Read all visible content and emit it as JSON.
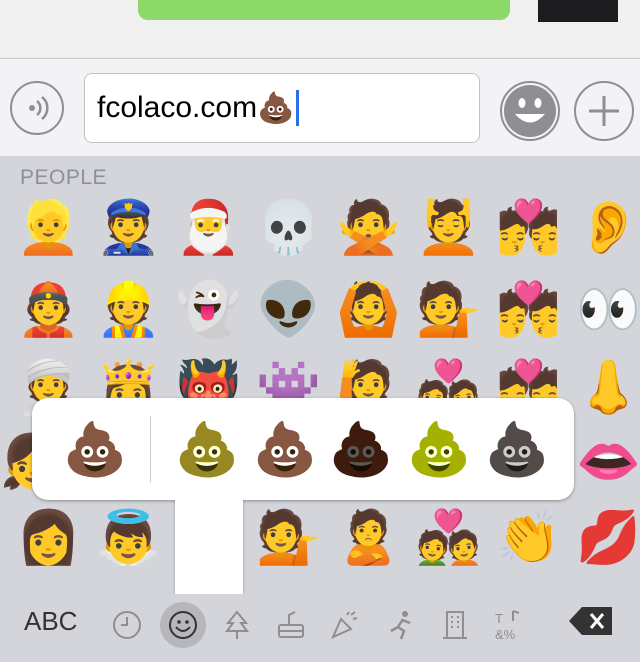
{
  "input": {
    "text": "fcolaco.com",
    "trailing_emoji": "💩"
  },
  "keyboard": {
    "section_title": "PEOPLE",
    "grid": [
      [
        "👱",
        "👮",
        "🎅",
        "💀",
        "🙅",
        "💆",
        "💏",
        "👂"
      ],
      [
        "👲",
        "👷",
        "👻",
        "👽",
        "🙆",
        "💁",
        "💏",
        "👀"
      ],
      [
        "👳",
        "👸",
        "👹",
        "👾",
        "🙋",
        "💑",
        "💏",
        "👃"
      ],
      [
        "👩",
        "👼",
        "",
        "💁",
        "🙎",
        "💑",
        "👏",
        "💋"
      ]
    ],
    "row4_left": "👧",
    "row4_right": "👄",
    "abc_label": "ABC",
    "categories": [
      "recent-icon",
      "smiley-icon",
      "tree-icon",
      "food-icon",
      "party-icon",
      "runner-icon",
      "building-icon",
      "symbols-icon"
    ]
  },
  "variant_popup": {
    "default": "💩",
    "variants": [
      "💩",
      "💩",
      "💩",
      "💩",
      "💩"
    ],
    "variant_filters": [
      "sepia(1) saturate(3) hue-rotate(15deg) brightness(1.1)",
      "none",
      "brightness(0.35) saturate(2)",
      "sepia(1) saturate(6) hue-rotate(30deg) brightness(1.3)",
      "grayscale(0.8) brightness(0.8)"
    ]
  },
  "colors": {
    "bubble": "#8cd96a",
    "caret": "#2a6ff0",
    "keyboard_bg": "#d3d5db"
  }
}
